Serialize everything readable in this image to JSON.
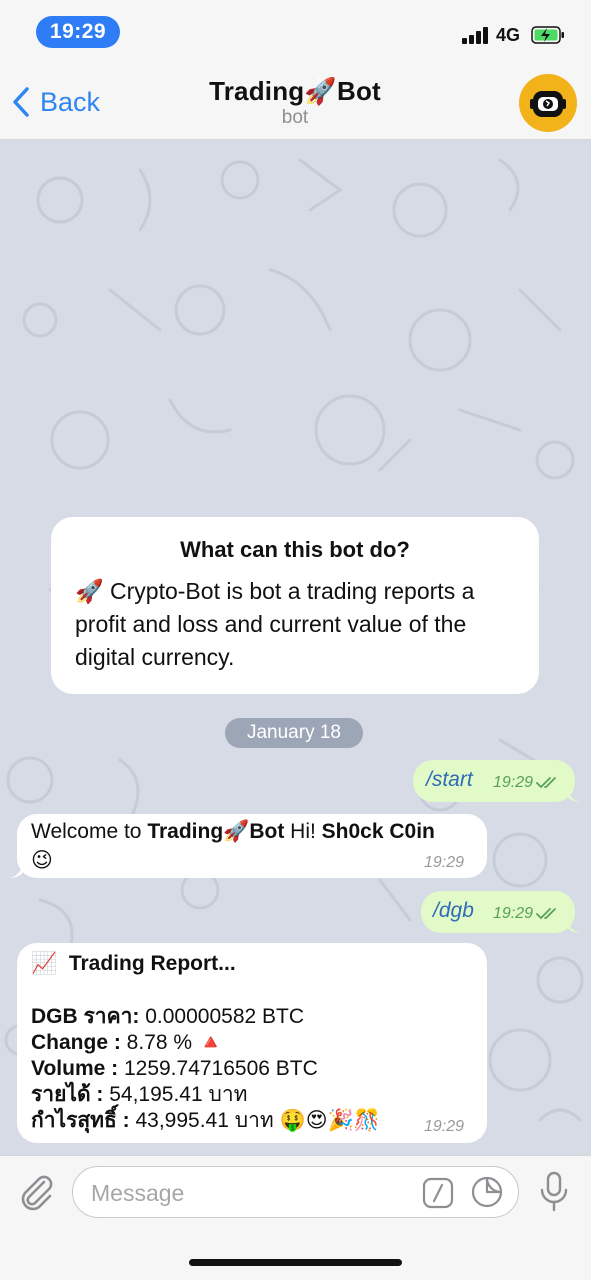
{
  "status_bar": {
    "time": "19:29",
    "network": "4G"
  },
  "nav": {
    "back_label": "Back",
    "title_text": "Trading",
    "title_emoji": "🚀",
    "title_text2": "Bot",
    "subtitle": "bot"
  },
  "info_card": {
    "title": "What can this bot do?",
    "emoji": "🚀",
    "text": "Crypto-Bot is bot a trading reports a profit and loss and current value of the digital currency."
  },
  "date_label": "January 18",
  "messages": {
    "start": {
      "text": "/start",
      "time": "19:29"
    },
    "welcome": {
      "prefix": "Welcome to ",
      "bot_name1": "Trading",
      "rocket": "🚀",
      "bot_name2": "Bot",
      "hi": " Hi! ",
      "user": "Sh0ck C0in",
      "emoji": "😉",
      "time": "19:29"
    },
    "dgb": {
      "text": "/dgb",
      "time": "19:29"
    },
    "report": {
      "header_emoji": "📈",
      "header": "Trading Report...",
      "line1_label": "DGB  ราคา:",
      "line1_value": " 0.00000582 BTC",
      "line2_label": "Change :",
      "line2_value": " 8.78 % ",
      "line2_emoji": "🔺",
      "line3_label": "Volume :",
      "line3_value": " 1259.74716506 BTC",
      "line4_label": "รายได้ :",
      "line4_value": " 54,195.41 บาท",
      "line5_label": "กำไรสุทธิ์ :",
      "line5_value": " 43,995.41 บาท ",
      "line5_emojis": "🤑😍🎉🎊",
      "time": "19:29"
    }
  },
  "input": {
    "placeholder": "Message"
  },
  "colors": {
    "accent": "#2f86f0",
    "outgoing": "#e1fac8",
    "chat_bg": "#d7dbe6",
    "avatar": "#f2b21a"
  }
}
